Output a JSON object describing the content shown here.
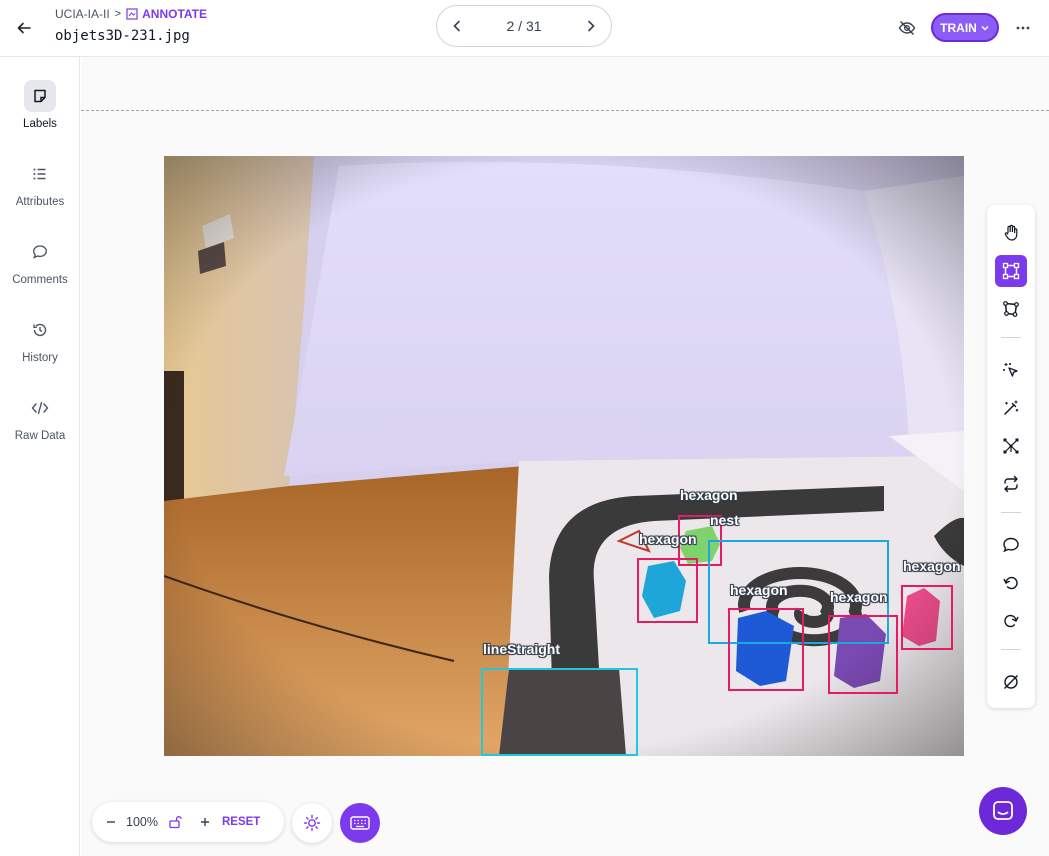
{
  "header": {
    "breadcrumb_project": "UCIA-IA-II",
    "breadcrumb_separator": ">",
    "breadcrumb_mode": "ANNOTATE",
    "file_name": "objets3D-231.jpg",
    "pager_text": "2 / 31",
    "train_label": "TRAIN"
  },
  "sidebar": {
    "items": [
      {
        "label": "Labels",
        "icon": "sticky-note-icon"
      },
      {
        "label": "Attributes",
        "icon": "list-icon"
      },
      {
        "label": "Comments",
        "icon": "speech-bubble-icon"
      },
      {
        "label": "History",
        "icon": "history-icon"
      },
      {
        "label": "Raw Data",
        "icon": "code-icon"
      }
    ]
  },
  "annotations": [
    {
      "label": "hexagon",
      "class": "green-hexagon"
    },
    {
      "label": "nest",
      "class": "spiral-nest"
    },
    {
      "label": "hexagon",
      "class": "cyan-hexagon"
    },
    {
      "label": "hexagon",
      "class": "pink-hexagon"
    },
    {
      "label": "hexagon",
      "class": "blue-hexagon"
    },
    {
      "label": "hexagon",
      "class": "purple-hexagon"
    },
    {
      "label": "lineStraight",
      "class": "straight-track"
    }
  ],
  "zoom": {
    "level": "100%",
    "reset_label": "RESET"
  },
  "colors": {
    "accent": "#7c3aed",
    "bbox_pink": "#e11d63",
    "bbox_cyan": "#22c7dd",
    "bbox_blue": "#1da7e0"
  }
}
